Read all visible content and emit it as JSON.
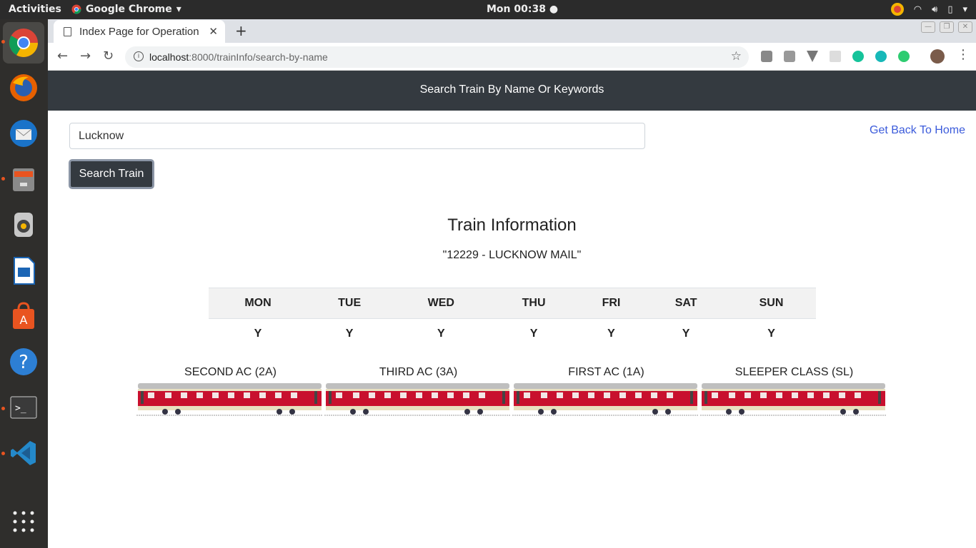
{
  "system": {
    "activities": "Activities",
    "app_name": "Google Chrome",
    "clock": "Mon 00:38"
  },
  "browser": {
    "tab_title": "Index Page for Operation",
    "url_host": "localhost",
    "url_rest": ":8000/trainInfo/search-by-name"
  },
  "page": {
    "header": "Search Train By Name Or Keywords",
    "search_value": "Lucknow",
    "search_button": "Search Train",
    "home_link": "Get Back To Home",
    "info_title": "Train Information",
    "train_name": "\"12229 - LUCKNOW MAIL\"",
    "days": [
      "MON",
      "TUE",
      "WED",
      "THU",
      "FRI",
      "SAT",
      "SUN"
    ],
    "runs": [
      "Y",
      "Y",
      "Y",
      "Y",
      "Y",
      "Y",
      "Y"
    ],
    "coaches": [
      "SECOND AC (2A)",
      "THIRD AC (3A)",
      "FIRST AC (1A)",
      "SLEEPER CLASS (SL)"
    ]
  },
  "colors": {
    "header_bg": "#343a40",
    "link": "#3b5bdb",
    "coach_red": "#c8102e"
  }
}
